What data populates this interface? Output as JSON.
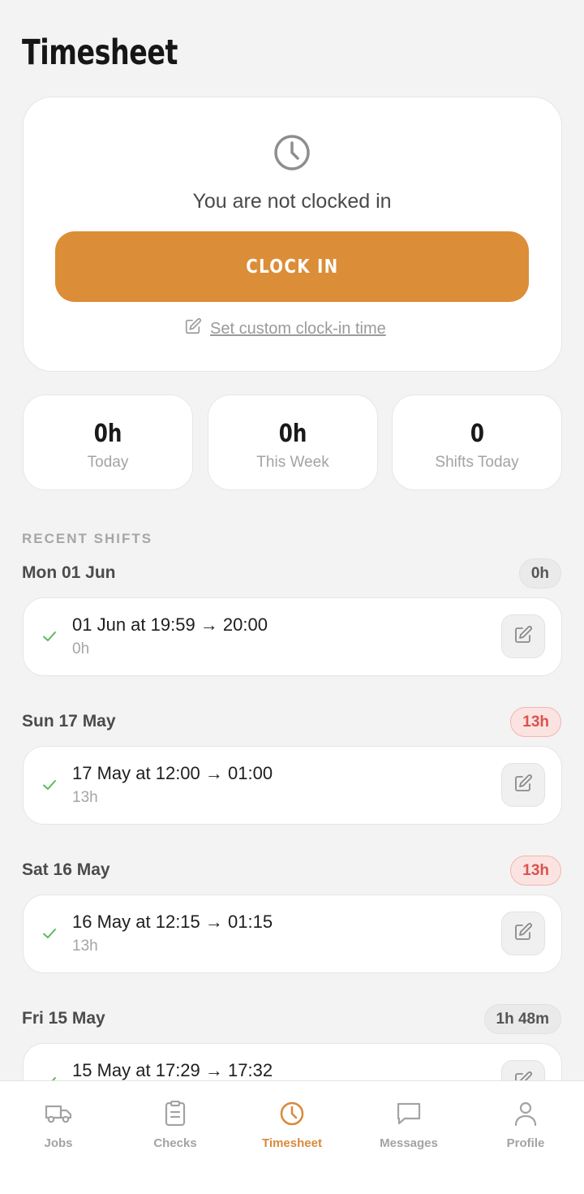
{
  "page": {
    "title": "Timesheet"
  },
  "clock": {
    "status": "You are not clocked in",
    "clock_in_label": "CLOCK IN",
    "custom_time_label": "Set custom clock-in time"
  },
  "stats": [
    {
      "value": "0h",
      "label": "Today"
    },
    {
      "value": "0h",
      "label": "This Week"
    },
    {
      "value": "0",
      "label": "Shifts Today"
    }
  ],
  "recent": {
    "heading": "RECENT SHIFTS",
    "days": [
      {
        "day": "Mon 01 Jun",
        "total": "0h",
        "total_style": "neutral",
        "shift": {
          "range": "01 Jun at 19:59 → 20:00",
          "duration": "0h"
        }
      },
      {
        "day": "Sun 17 May",
        "total": "13h",
        "total_style": "warn",
        "shift": {
          "range": "17 May at 12:00 → 01:00",
          "duration": "13h"
        }
      },
      {
        "day": "Sat 16 May",
        "total": "13h",
        "total_style": "warn",
        "shift": {
          "range": "16 May at 12:15 → 01:15",
          "duration": "13h"
        }
      },
      {
        "day": "Fri 15 May",
        "total": "1h 48m",
        "total_style": "neutral",
        "shift": {
          "range": "15 May at 17:29 → 17:32",
          "duration": ""
        }
      }
    ]
  },
  "tabs": [
    {
      "label": "Jobs",
      "icon": "truck-icon"
    },
    {
      "label": "Checks",
      "icon": "clipboard-icon"
    },
    {
      "label": "Timesheet",
      "icon": "clock-icon",
      "active": true
    },
    {
      "label": "Messages",
      "icon": "message-icon"
    },
    {
      "label": "Profile",
      "icon": "user-icon"
    }
  ],
  "colors": {
    "accent": "#dc8d37",
    "warn": "#d9534f",
    "check": "#5cb85c"
  }
}
